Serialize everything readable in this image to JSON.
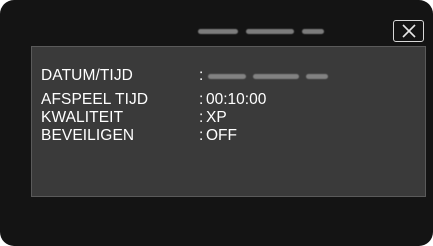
{
  "window": {
    "close_icon": "close-x-icon"
  },
  "info": {
    "rows": [
      {
        "label": "DATUM/TIJD",
        "separator": ":",
        "value": ""
      },
      {
        "label": "AFSPEEL TIJD",
        "separator": ":",
        "value": "00:10:00"
      },
      {
        "label": "KWALITEIT",
        "separator": ":",
        "value": "XP"
      },
      {
        "label": "BEVEILIGEN",
        "separator": ":",
        "value": "OFF"
      }
    ]
  },
  "colors": {
    "screen_bg": "#141414",
    "panel_bg": "#3a3a3a",
    "text": "#ffffff"
  }
}
